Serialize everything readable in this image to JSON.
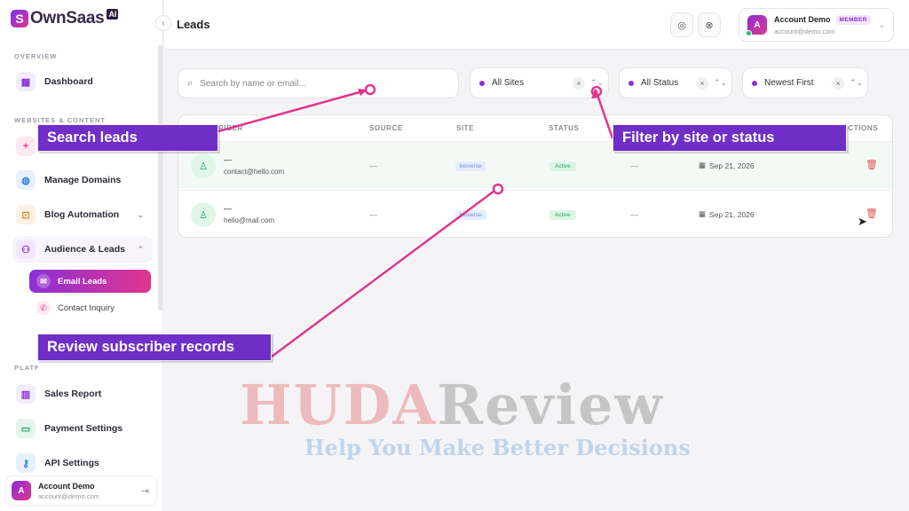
{
  "brand": {
    "name": "OwnSaas",
    "ai": "AI",
    "mark": "S"
  },
  "sidebar": {
    "collapse_icon": "chevron-left-icon",
    "sections": [
      {
        "label": "OVERVIEW"
      },
      {
        "label": "WEBSITES & CONTENT"
      },
      {
        "label": "PLATF"
      }
    ],
    "items": {
      "dashboard": {
        "label": "Dashboard",
        "icon": "grid-icon"
      },
      "add_site": {
        "label": "+",
        "icon": "plus-icon"
      },
      "manage_domains": {
        "label": "Manage Domains",
        "icon": "globe-icon"
      },
      "blog_automation": {
        "label": "Blog Automation",
        "icon": "robot-icon"
      },
      "audience_leads": {
        "label": "Audience & Leads",
        "icon": "users-icon"
      },
      "sales_report": {
        "label": "Sales Report",
        "icon": "bar-chart-icon"
      },
      "payment_settings": {
        "label": "Payment Settings",
        "icon": "credit-card-icon"
      },
      "api_settings": {
        "label": "API Settings",
        "icon": "key-icon"
      }
    },
    "sub_items": {
      "email_leads": {
        "label": "Email Leads",
        "icon": "mail-icon"
      },
      "contact_inquiry": {
        "label": "Contact Inquiry",
        "icon": "phone-icon"
      }
    },
    "account": {
      "avatar": "A",
      "name": "Account Demo",
      "email": "account@demo.com"
    }
  },
  "header": {
    "title": "Leads",
    "account": {
      "avatar": "A",
      "name": "Account Demo",
      "badge": "MEMBER",
      "email": "account@demo.com"
    }
  },
  "filters": {
    "search_placeholder": "Search by name or email...",
    "site": "All Sites",
    "status": "All Status",
    "sort": "Newest First",
    "clear": "×",
    "sort_arrows": "⌃⌄"
  },
  "table": {
    "columns": [
      "SUBSCRIBER",
      "SOURCE",
      "SITE",
      "STATUS",
      "ACTIONS"
    ],
    "rows": [
      {
        "name": "—",
        "email": "contact@hello.com",
        "source": "—",
        "site": "bioverse",
        "status": "Active",
        "extra": "—",
        "date": "Sep 21, 2026"
      },
      {
        "name": "—",
        "email": "hello@mail.com",
        "source": "—",
        "site": "bioverse",
        "status": "Active",
        "extra": "—",
        "date": "Sep 21, 2026"
      }
    ]
  },
  "annotations": {
    "search": "Search leads",
    "filter": "Filter by site or status",
    "review": "Review subscriber records"
  },
  "watermark": {
    "huda": "HUDA",
    "review": "Review",
    "tagline": "Help You Make Better Decisions"
  },
  "colors": {
    "accent": "#8b2fd6",
    "accent2": "#e0368c",
    "callout": "#6f2ec6",
    "arrow": "#e0368c"
  }
}
